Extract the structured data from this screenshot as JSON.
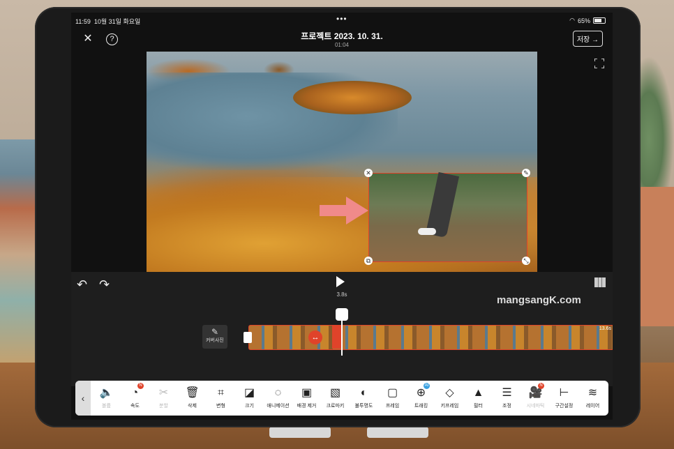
{
  "status": {
    "time": "11:59",
    "date": "10월 31일 화요일",
    "battery": "65%"
  },
  "header": {
    "title": "프로젝트 2023. 10. 31.",
    "subtitle": "01:04",
    "save_label": "저장 →"
  },
  "player": {
    "time": "3.8s",
    "watermark": "mangsangK.com"
  },
  "timeline": {
    "cover_label": "커버사진",
    "duration": "13.6s"
  },
  "toolbar": {
    "tools": [
      {
        "label": "볼륨",
        "icon": "volume-icon",
        "disabled": true,
        "glyph": "🔈"
      },
      {
        "label": "속도",
        "icon": "speed-icon",
        "badge": "N",
        "glyph": "◔"
      },
      {
        "label": "분할",
        "icon": "scissors-icon",
        "disabled": true,
        "glyph": "✂"
      },
      {
        "label": "삭제",
        "icon": "trash-icon",
        "glyph": "🗑"
      },
      {
        "label": "변형",
        "icon": "crop-icon",
        "glyph": "⌗"
      },
      {
        "label": "크기",
        "icon": "resize-icon",
        "glyph": "◪"
      },
      {
        "label": "애니메이션",
        "icon": "animation-icon",
        "glyph": "◌"
      },
      {
        "label": "배경 제거",
        "icon": "bg-remove-icon",
        "glyph": "▣"
      },
      {
        "label": "크로마키",
        "icon": "chromakey-icon",
        "glyph": "▧"
      },
      {
        "label": "불투명도",
        "icon": "opacity-icon",
        "glyph": "◐"
      },
      {
        "label": "프레임",
        "icon": "frame-icon",
        "glyph": "▢"
      },
      {
        "label": "트래킹",
        "icon": "tracking-icon",
        "badge": "AI",
        "badge_color": "blue",
        "glyph": "⊕"
      },
      {
        "label": "키프레임",
        "icon": "keyframe-icon",
        "glyph": "◇"
      },
      {
        "label": "필터",
        "icon": "filter-icon",
        "glyph": "▲"
      },
      {
        "label": "조정",
        "icon": "adjust-icon",
        "glyph": "☰"
      },
      {
        "label": "시네마틱",
        "icon": "cinematic-icon",
        "disabled": true,
        "badge": "N",
        "glyph": "🎥"
      },
      {
        "label": "구간설정",
        "icon": "range-icon",
        "glyph": "⊢"
      },
      {
        "label": "레이어",
        "icon": "layer-icon",
        "glyph": "≋"
      }
    ]
  },
  "colors": {
    "accent": "#e0432a",
    "background": "#111111",
    "panel": "#1e1e1e"
  }
}
